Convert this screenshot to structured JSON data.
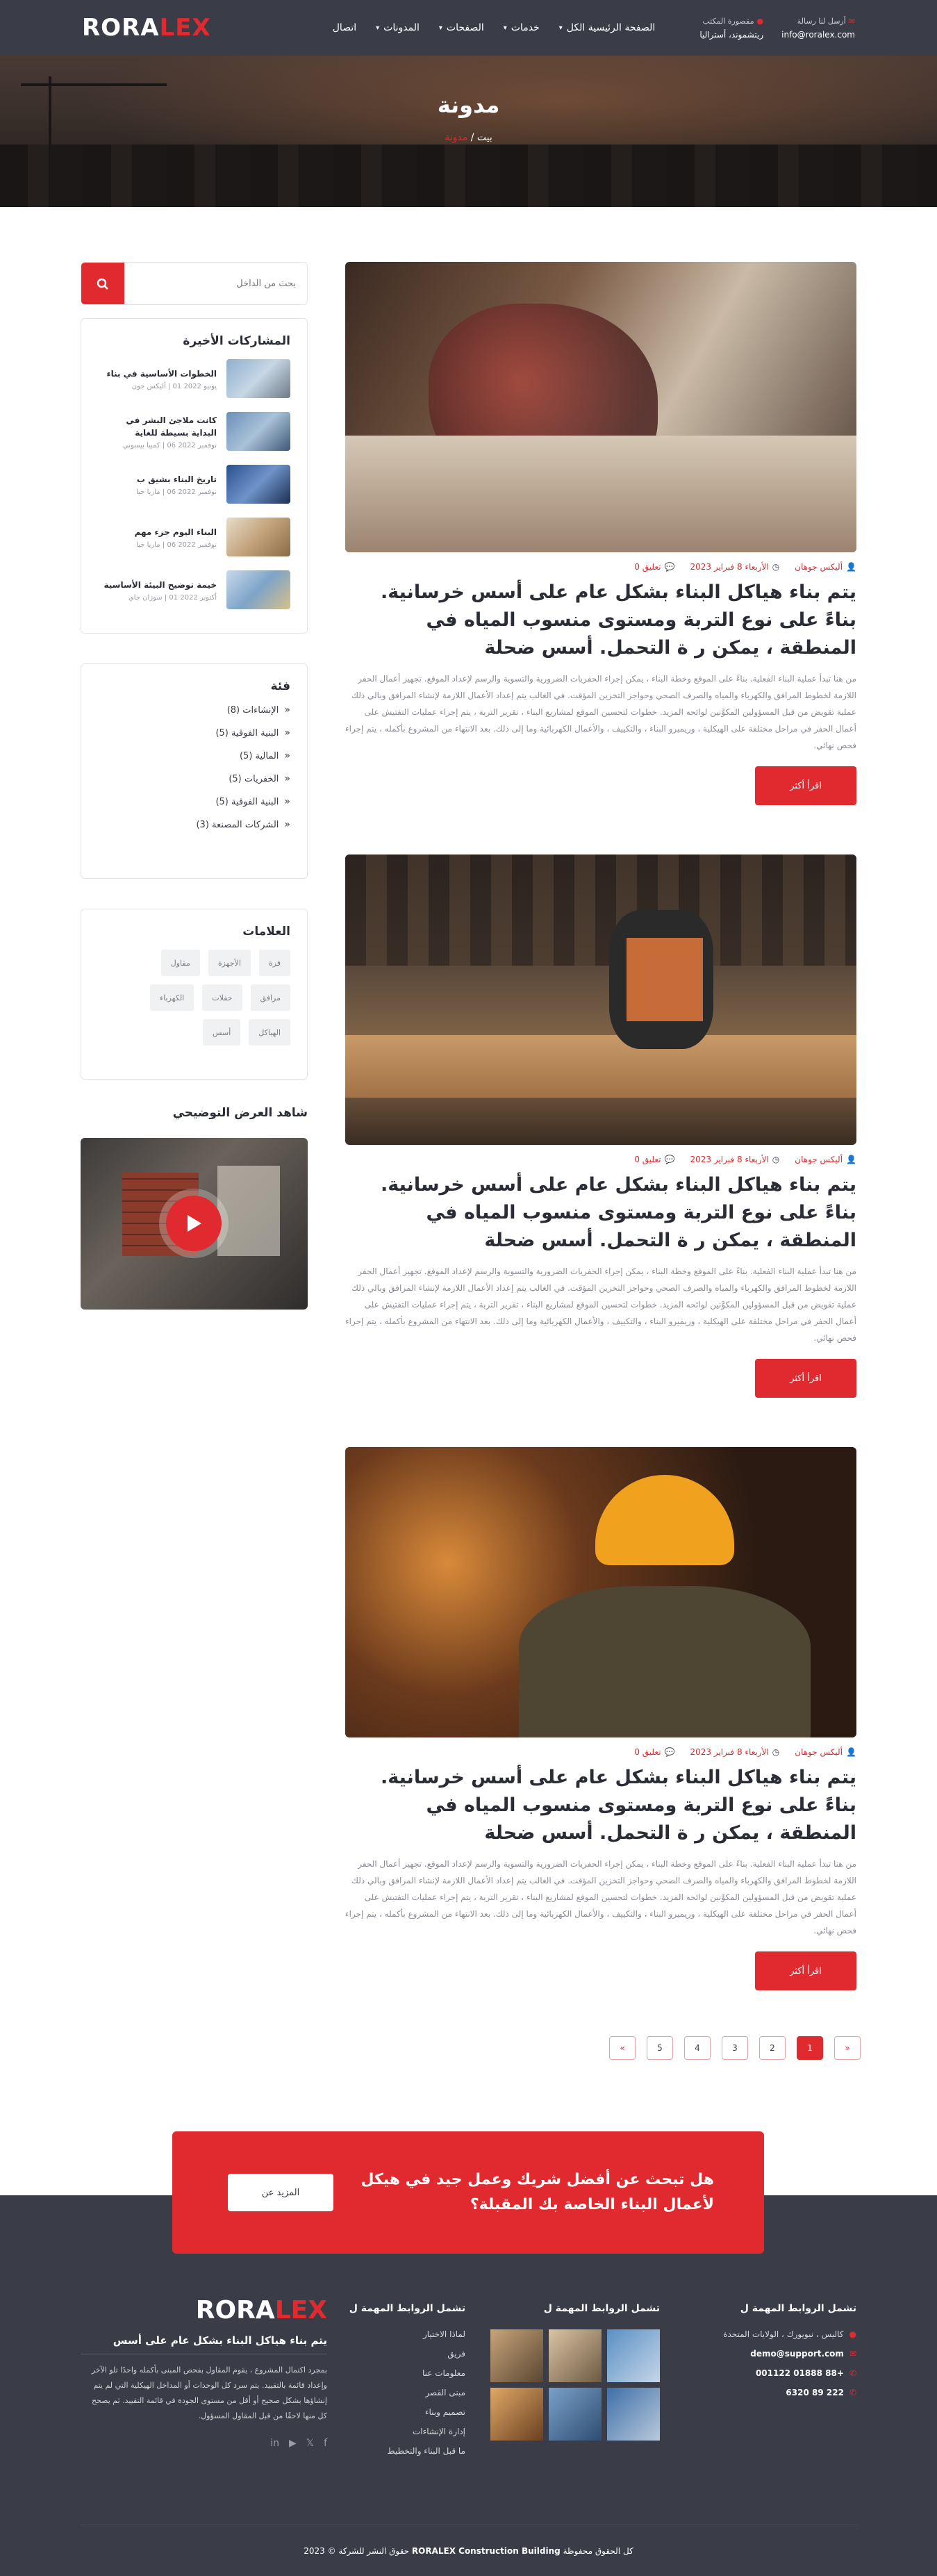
{
  "brand": {
    "logo_a": "RORA",
    "logo_b": "LEX"
  },
  "header": {
    "nav": [
      {
        "label": "الصفحة الرئيسية الكل",
        "has_menu": true
      },
      {
        "label": "خدمات",
        "has_menu": true
      },
      {
        "label": "الصفحات",
        "has_menu": true
      },
      {
        "label": "المدونات",
        "has_menu": true
      },
      {
        "label": "اتصال",
        "has_menu": false
      }
    ],
    "contact": [
      {
        "title": "أرسل لنا رسالة",
        "value": "info@roralex.com"
      },
      {
        "title": "مقصورة المكتب",
        "value": "ريتشموند، أستراليا"
      }
    ]
  },
  "banner": {
    "title": "مدونة",
    "crumb_home": "بيت",
    "crumb_sep": "/",
    "crumb_current": "مدونة"
  },
  "posts": [
    {
      "author": "أليكس جوهان",
      "date": "الأربعاء 8 فبراير 2023",
      "comments": "تعليق 0",
      "title": "يتم بناء هياكل البناء بشكل عام على أسس خرسانية. بناءً على نوع التربة ومستوى منسوب المياه في المنطقة ، يمكن ر ة التحمل. أسس ضحلة",
      "excerpt": "من هنا تبدأ عملية البناء الفعلية. بناءً على الموقع وخطة البناء ، يمكن إجراء الحفريات الضرورية والتسوية والرسم لإعداد الموقع. تجهيز أعمال الحفر اللازمة لخطوط المرافق والكهرباء والمياه والصرف الصحي وحواجز التخزين المؤقت. في الغالب يتم إعداد الأعمال اللازمة لإنشاء المرافق وبالي ذلك عملية تقويض من قبل المسؤولين المكوَّنين لوائحه المزيد. خطوات لتحسين الموقع لمشاريع البناء ، تقرير التربة ، يتم إجراء عمليات التفتيش على أعمال الحفر في مراحل مختلفة على الهيكلية ، وريميرو البناء ، والتكييف ، والأعمال الكهربائية وما إلى ذلك. بعد الانتهاء من المشروع بأكمله ، يتم إجراء فحص نهائي.",
      "button": "اقرأ أكثر"
    },
    {
      "author": "أليكس جوهان",
      "date": "الأربعاء 8 فبراير 2023",
      "comments": "تعليق 0",
      "title": "يتم بناء هياكل البناء بشكل عام على أسس خرسانية. بناءً على نوع التربة ومستوى منسوب المياه في المنطقة ، يمكن ر ة التحمل. أسس ضحلة",
      "excerpt": "من هنا تبدأ عملية البناء الفعلية. بناءً على الموقع وخطة البناء ، يمكن إجراء الحفريات الضرورية والتسوية والرسم لإعداد الموقع. تجهيز أعمال الحفر اللازمة لخطوط المرافق والكهرباء والمياه والصرف الصحي وحواجز التخزين المؤقت. في الغالب يتم إعداد الأعمال اللازمة لإنشاء المرافق وبالي ذلك عملية تقويض من قبل المسؤولين المكوَّنين لوائحه المزيد. خطوات لتحسين الموقع لمشاريع البناء ، تقرير التربة ، يتم إجراء عمليات التفتيش على أعمال الحفر في مراحل مختلفة على الهيكلية ، وريميرو البناء ، والتكييف ، والأعمال الكهربائية وما إلى ذلك. بعد الانتهاء من المشروع بأكمله ، يتم إجراء فحص نهائي.",
      "button": "اقرأ أكثر"
    },
    {
      "author": "أليكس جوهان",
      "date": "الأربعاء 8 فبراير 2023",
      "comments": "تعليق 0",
      "title": "يتم بناء هياكل البناء بشكل عام على أسس خرسانية. بناءً على نوع التربة ومستوى منسوب المياه في المنطقة ، يمكن ر ة التحمل. أسس ضحلة",
      "excerpt": "من هنا تبدأ عملية البناء الفعلية. بناءً على الموقع وخطة البناء ، يمكن إجراء الحفريات الضرورية والتسوية والرسم لإعداد الموقع. تجهيز أعمال الحفر اللازمة لخطوط المرافق والكهرباء والمياه والصرف الصحي وحواجز التخزين المؤقت. في الغالب يتم إعداد الأعمال اللازمة لإنشاء المرافق وبالي ذلك عملية تقويض من قبل المسؤولين المكوَّنين لوائحه المزيد. خطوات لتحسين الموقع لمشاريع البناء ، تقرير التربة ، يتم إجراء عمليات التفتيش على أعمال الحفر في مراحل مختلفة على الهيكلية ، وريميرو البناء ، والتكييف ، والأعمال الكهربائية وما إلى ذلك. بعد الانتهاء من المشروع بأكمله ، يتم إجراء فحص نهائي.",
      "button": "اقرأ أكثر"
    }
  ],
  "sidebar": {
    "search_placeholder": "بحث من الداخل",
    "recent_title": "المشاركات الأخيرة",
    "recent": [
      {
        "title": "الخطوات الأساسية في بناء",
        "date": "يونيو 2022 01 | أليكس جون"
      },
      {
        "title": "كانت ملاجئ البشر في البداية بسيطة للغاية",
        "date": "نوفمبر 2022 06 | كمبيا بيسوني"
      },
      {
        "title": "تاريخ البناء بشيق ب",
        "date": "نوفمبر 2022 06 | ماريا جيا"
      },
      {
        "title": "البناء اليوم جزء مهم",
        "date": "نوفمبر 2022 06 | ماريا جيا"
      },
      {
        "title": "خيمة توضيح البيئة الأساسية",
        "date": "أكتوبر 2022 01 | سوزان جاي"
      }
    ],
    "category_title": "فئة",
    "categories": [
      "الإنشاءات (8)",
      "البنية الفوقية (5)",
      "المالية (5)",
      "الخفريات (5)",
      "البنية الفوقية (5)",
      "الشركات المصنعة (3)"
    ],
    "tags_title": "العلامات",
    "tags": [
      "قرة",
      "الأجهزة",
      "مقاول",
      "مرافق",
      "حفلات",
      "الكهرباء",
      "الهياكل",
      "أسس"
    ],
    "video_title": "شاهد العرض التوضيحي"
  },
  "pagination": [
    "«",
    "1",
    "2",
    "3",
    "4",
    "5",
    "»"
  ],
  "cta": {
    "title": "هل تبحث عن أفضل شريك وعمل جيد في هيكل لأعمال البناء الخاصة بك المقبلة؟",
    "button": "المزيد عن"
  },
  "footer": {
    "contact_title": "تشمل الروابط المهمة ل",
    "contact": [
      {
        "icon": "location-icon",
        "text": "كاليس ، نيويورك ، الولايات المتحدة"
      },
      {
        "icon": "mail-icon",
        "text": "demo@support.com"
      },
      {
        "icon": "phone-icon",
        "text": "+88 01888 001122"
      },
      {
        "icon": "phone-icon",
        "text": "222 89 6320"
      }
    ],
    "gallery_title": "تشمل الروابط المهمة ل",
    "links_title": "تشمل الروابط المهمة ل",
    "links": [
      "لماذا الاختيار",
      "فريق",
      "معلومات عنا",
      "مبنى القصر",
      "تصميم وبناء",
      "إدارة الإنشاءات",
      "ما قبل البناء والتخطيط"
    ],
    "about_title": "يتم بناء هياكل البناء بشكل عام على أسس",
    "about_text": "بمجرد اكتمال المشروع ، يقوم المقاول بفحص المبنى بأكمله واحدًا تلو الآخر وإعداد قائمة بالتقييد. يتم سرد كل الوحدات أو المداخل الهيكلية التي لم يتم إنشاؤها بشكل صحيح أو أقل من مستوى الجودة في قائمة التقييد. ثم يصحح كل منها لاحقًا من قبل المقاول المسؤول.",
    "copyright_pre": "كل الحقوق محفوظة",
    "copyright_brand": "RORALEX Construction Building",
    "copyright_post": "حقوق النشر للشركة © 2023"
  },
  "colors": {
    "accent": "#e02a2f",
    "dark": "#3a3d48"
  }
}
